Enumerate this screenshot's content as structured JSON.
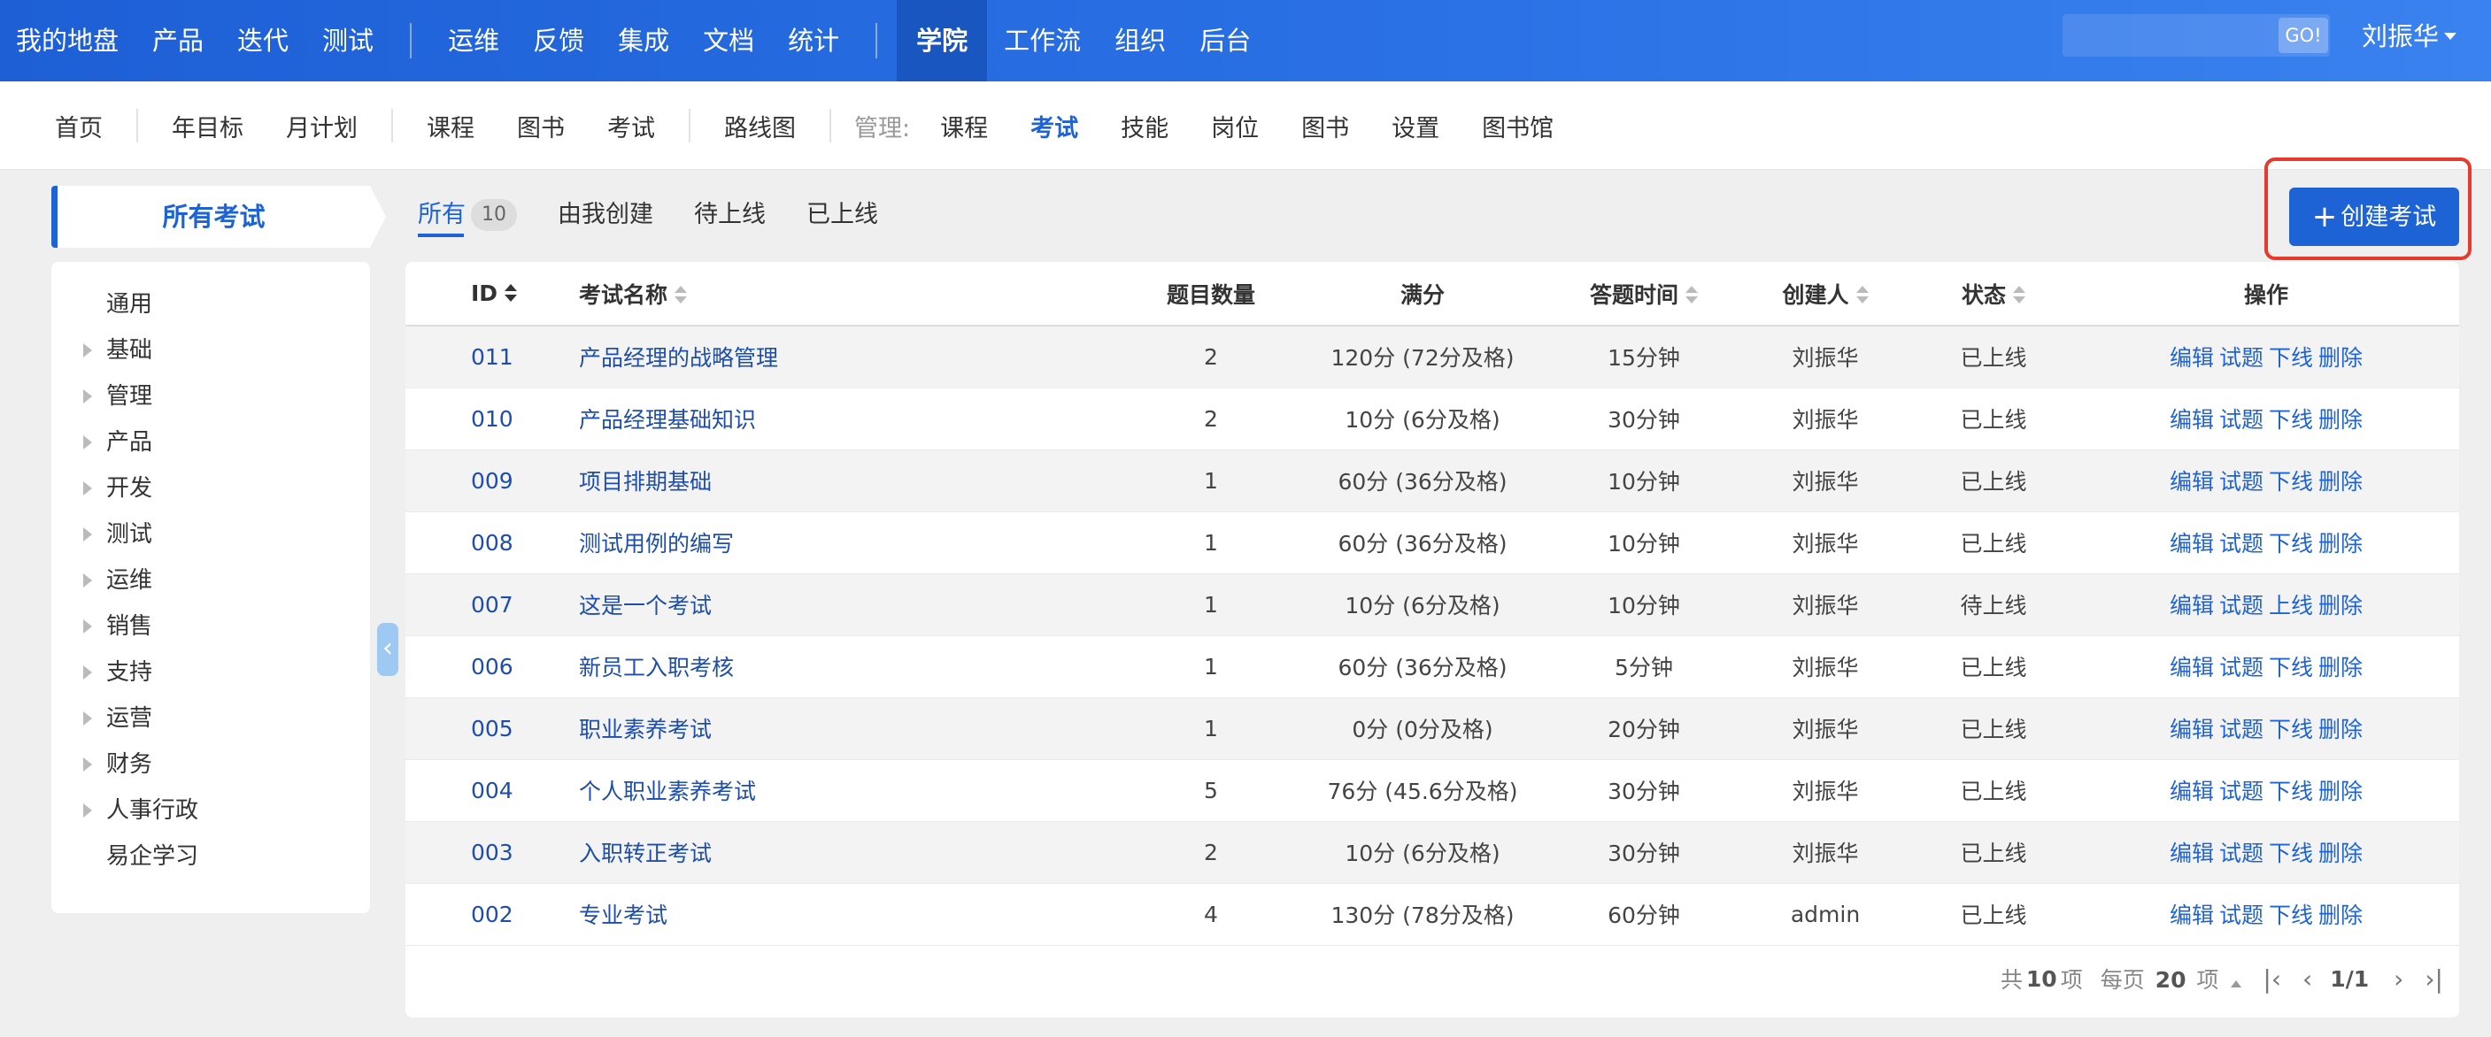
{
  "topnav": {
    "left": [
      "我的地盘",
      "产品",
      "迭代",
      "测试"
    ],
    "mid": [
      "运维",
      "反馈",
      "集成",
      "文档",
      "统计"
    ],
    "active": "学院",
    "right": [
      "工作流",
      "组织",
      "后台"
    ],
    "search_placeholder": "",
    "search_button": "GO!",
    "user": "刘振华"
  },
  "subnav": {
    "group1": [
      "首页"
    ],
    "group2": [
      "年目标",
      "月计划"
    ],
    "group3": [
      "课程",
      "图书",
      "考试"
    ],
    "group4": [
      "路线图"
    ],
    "manage_label": "管理:",
    "manage_items": [
      "课程",
      "考试",
      "技能",
      "岗位",
      "图书",
      "设置",
      "图书馆"
    ],
    "manage_active": "考试"
  },
  "sidebar": {
    "title": "所有考试",
    "items": [
      {
        "label": "通用",
        "expandable": false
      },
      {
        "label": "基础",
        "expandable": true
      },
      {
        "label": "管理",
        "expandable": true
      },
      {
        "label": "产品",
        "expandable": true
      },
      {
        "label": "开发",
        "expandable": true
      },
      {
        "label": "测试",
        "expandable": true
      },
      {
        "label": "运维",
        "expandable": true
      },
      {
        "label": "销售",
        "expandable": true
      },
      {
        "label": "支持",
        "expandable": true
      },
      {
        "label": "运营",
        "expandable": true
      },
      {
        "label": "财务",
        "expandable": true
      },
      {
        "label": "人事行政",
        "expandable": true
      },
      {
        "label": "易企学习",
        "expandable": false
      }
    ],
    "collapse_glyph": "‹"
  },
  "tabs": {
    "all": "所有",
    "all_count": "10",
    "mine": "由我创建",
    "pending": "待上线",
    "online": "已上线"
  },
  "create_button": {
    "icon": "+",
    "label": "创建考试"
  },
  "table": {
    "headers": {
      "id": "ID",
      "name": "考试名称",
      "count": "题目数量",
      "score": "满分",
      "time": "答题时间",
      "creator": "创建人",
      "status": "状态",
      "ops": "操作"
    },
    "rows": [
      {
        "id": "011",
        "name": "产品经理的战略管理",
        "count": "2",
        "score": "120分 (72分及格)",
        "time": "15分钟",
        "creator": "刘振华",
        "status": "已上线",
        "ops": [
          "编辑",
          "试题",
          "下线",
          "删除"
        ]
      },
      {
        "id": "010",
        "name": "产品经理基础知识",
        "count": "2",
        "score": "10分 (6分及格)",
        "time": "30分钟",
        "creator": "刘振华",
        "status": "已上线",
        "ops": [
          "编辑",
          "试题",
          "下线",
          "删除"
        ]
      },
      {
        "id": "009",
        "name": "项目排期基础",
        "count": "1",
        "score": "60分 (36分及格)",
        "time": "10分钟",
        "creator": "刘振华",
        "status": "已上线",
        "ops": [
          "编辑",
          "试题",
          "下线",
          "删除"
        ]
      },
      {
        "id": "008",
        "name": "测试用例的编写",
        "count": "1",
        "score": "60分 (36分及格)",
        "time": "10分钟",
        "creator": "刘振华",
        "status": "已上线",
        "ops": [
          "编辑",
          "试题",
          "下线",
          "删除"
        ]
      },
      {
        "id": "007",
        "name": "这是一个考试",
        "count": "1",
        "score": "10分 (6分及格)",
        "time": "10分钟",
        "creator": "刘振华",
        "status": "待上线",
        "ops": [
          "编辑",
          "试题",
          "上线",
          "删除"
        ]
      },
      {
        "id": "006",
        "name": "新员工入职考核",
        "count": "1",
        "score": "60分 (36分及格)",
        "time": "5分钟",
        "creator": "刘振华",
        "status": "已上线",
        "ops": [
          "编辑",
          "试题",
          "下线",
          "删除"
        ]
      },
      {
        "id": "005",
        "name": "职业素养考试",
        "count": "1",
        "score": "0分 (0分及格)",
        "time": "20分钟",
        "creator": "刘振华",
        "status": "已上线",
        "ops": [
          "编辑",
          "试题",
          "下线",
          "删除"
        ]
      },
      {
        "id": "004",
        "name": "个人职业素养考试",
        "count": "5",
        "score": "76分 (45.6分及格)",
        "time": "30分钟",
        "creator": "刘振华",
        "status": "已上线",
        "ops": [
          "编辑",
          "试题",
          "下线",
          "删除"
        ]
      },
      {
        "id": "003",
        "name": "入职转正考试",
        "count": "2",
        "score": "10分 (6分及格)",
        "time": "30分钟",
        "creator": "刘振华",
        "status": "已上线",
        "ops": [
          "编辑",
          "试题",
          "下线",
          "删除"
        ]
      },
      {
        "id": "002",
        "name": "专业考试",
        "count": "4",
        "score": "130分 (78分及格)",
        "time": "60分钟",
        "creator": "admin",
        "status": "已上线",
        "ops": [
          "编辑",
          "试题",
          "下线",
          "删除"
        ]
      }
    ]
  },
  "pager": {
    "total_prefix": "共",
    "total": "10",
    "total_suffix": "项",
    "per_prefix": "每页",
    "per": "20",
    "per_suffix": "项",
    "page": "1/1",
    "first": "|‹",
    "prev": "‹",
    "next": "›",
    "last": "›|"
  },
  "colors": {
    "primary": "#1e63d6",
    "highlight_border": "#e53a2e",
    "link": "#1e4ea8"
  }
}
